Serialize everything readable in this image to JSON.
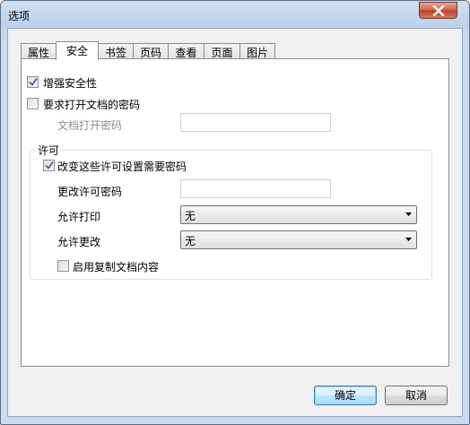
{
  "window": {
    "title": "选项"
  },
  "tabs": [
    {
      "label": "属性"
    },
    {
      "label": "安全"
    },
    {
      "label": "书签"
    },
    {
      "label": "页码"
    },
    {
      "label": "查看"
    },
    {
      "label": "页面"
    },
    {
      "label": "图片"
    }
  ],
  "active_tab": "安全",
  "security": {
    "enhance_label": "增强安全性",
    "enhance_checked": true,
    "require_open_password_label": "要求打开文档的密码",
    "require_open_password_checked": false,
    "open_password_label": "文档打开密码",
    "open_password_value": "",
    "permissions": {
      "legend": "许可",
      "change_requires_password_label": "改变这些许可设置需要密码",
      "change_requires_password_checked": true,
      "change_password_label": "更改许可密码",
      "change_password_value": "",
      "allow_print_label": "允许打印",
      "allow_print_value": "无",
      "allow_change_label": "允许更改",
      "allow_change_value": "无",
      "enable_copy_label": "启用复制文档内容",
      "enable_copy_checked": false
    }
  },
  "buttons": {
    "ok": "确定",
    "cancel": "取消"
  },
  "icons": {
    "close": "close-icon",
    "check": "checkmark-icon",
    "dropdown": "chevron-down-icon"
  },
  "colors": {
    "titlebar": "#bcd3ec",
    "close": "#c23c22",
    "default_button": "#3c7fb1"
  }
}
